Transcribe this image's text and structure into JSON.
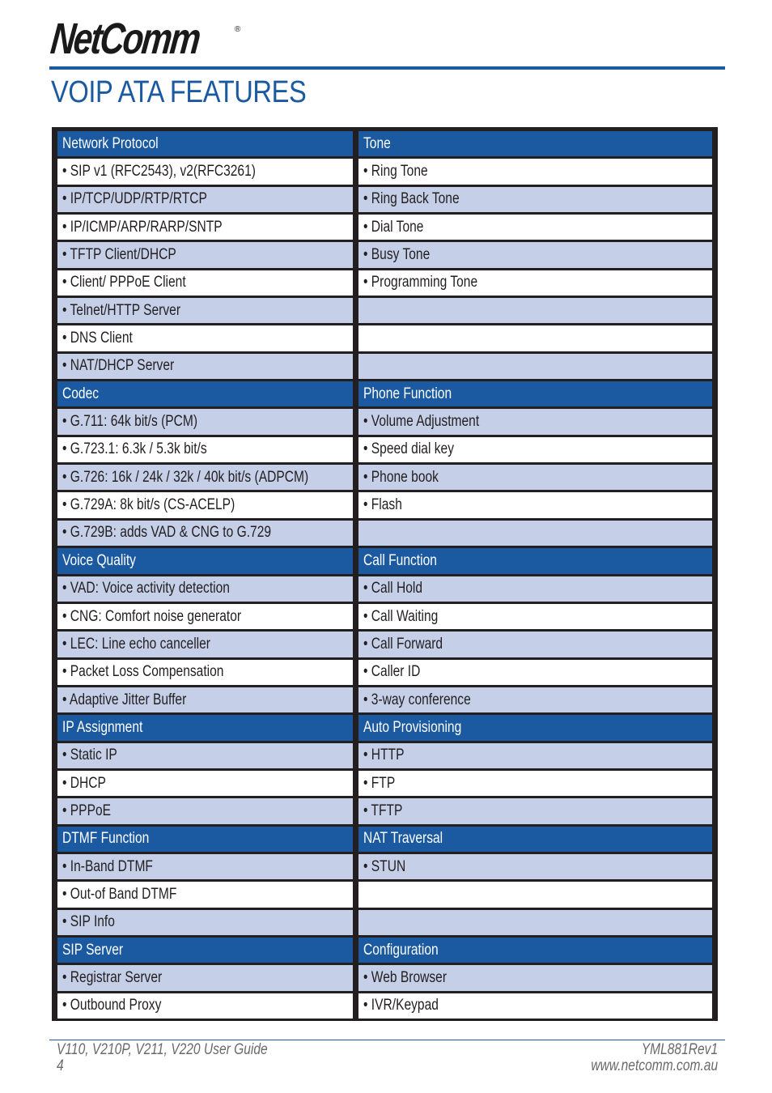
{
  "header": {
    "logo_text": "NetComm",
    "logo_mark": "®",
    "title": "VOIP ATA FEATURES"
  },
  "colors": {
    "brand_blue": "#1b5aa0",
    "row_shade": "#c5cfe8",
    "frame": "#231f20"
  },
  "table": {
    "rows": [
      {
        "type": "head",
        "left": "Network Protocol",
        "right": "Tone"
      },
      {
        "type": "plain",
        "left": "• SIP v1 (RFC2543), v2(RFC3261)",
        "right": "• Ring Tone"
      },
      {
        "type": "shade",
        "left": "• IP/TCP/UDP/RTP/RTCP",
        "right": "• Ring Back Tone"
      },
      {
        "type": "plain",
        "left": "• IP/ICMP/ARP/RARP/SNTP",
        "right": "• Dial Tone"
      },
      {
        "type": "shade",
        "left": "• TFTP Client/DHCP",
        "right": "• Busy Tone"
      },
      {
        "type": "plain",
        "left": "• Client/ PPPoE Client",
        "right": "• Programming Tone"
      },
      {
        "type": "shade",
        "left": "• Telnet/HTTP Server",
        "right": ""
      },
      {
        "type": "plain",
        "left": "• DNS Client",
        "right": ""
      },
      {
        "type": "shade",
        "left": "• NAT/DHCP Server",
        "right": ""
      },
      {
        "type": "head",
        "left": "Codec",
        "right": "Phone Function"
      },
      {
        "type": "shade",
        "left": "• G.711: 64k bit/s (PCM)",
        "right": "• Volume Adjustment"
      },
      {
        "type": "plain",
        "left": "• G.723.1: 6.3k / 5.3k bit/s",
        "right": "• Speed dial key"
      },
      {
        "type": "shade",
        "left": "• G.726: 16k / 24k / 32k / 40k bit/s (ADPCM)",
        "right": "• Phone book"
      },
      {
        "type": "plain",
        "left": "• G.729A: 8k bit/s (CS-ACELP)",
        "right": "• Flash"
      },
      {
        "type": "shade",
        "left": "• G.729B: adds VAD & CNG to G.729",
        "right": ""
      },
      {
        "type": "head",
        "left": "Voice Quality",
        "right": "Call Function"
      },
      {
        "type": "shade",
        "left": "• VAD: Voice activity detection",
        "right": "• Call Hold"
      },
      {
        "type": "plain",
        "left": "• CNG: Comfort noise generator",
        "right": "• Call Waiting"
      },
      {
        "type": "shade",
        "left": "• LEC: Line echo canceller",
        "right": "• Call Forward"
      },
      {
        "type": "plain",
        "left": "• Packet Loss Compensation",
        "right": "• Caller ID"
      },
      {
        "type": "shade",
        "left": "• Adaptive Jitter Buffer",
        "right": "• 3-way conference"
      },
      {
        "type": "head",
        "left": "IP Assignment",
        "right": "Auto Provisioning"
      },
      {
        "type": "shade",
        "left": "• Static IP",
        "right": "• HTTP"
      },
      {
        "type": "plain",
        "left": "• DHCP",
        "right": "• FTP"
      },
      {
        "type": "shade",
        "left": "• PPPoE",
        "right": "• TFTP"
      },
      {
        "type": "head",
        "left": "DTMF Function",
        "right": "NAT Traversal"
      },
      {
        "type": "shade",
        "left": "• In-Band DTMF",
        "right": "• STUN"
      },
      {
        "type": "plain",
        "left": "• Out-of Band DTMF",
        "right": ""
      },
      {
        "type": "shade",
        "left": "• SIP Info",
        "right": ""
      },
      {
        "type": "head",
        "left": "SIP Server",
        "right": "Configuration"
      },
      {
        "type": "shade",
        "left": "• Registrar Server",
        "right": "• Web Browser"
      },
      {
        "type": "plain",
        "left": "• Outbound Proxy",
        "right": "• IVR/Keypad"
      }
    ]
  },
  "footer": {
    "guide": "V110, V210P, V211, V220 User Guide",
    "page_number": "4",
    "doc_code": "YML881Rev1",
    "website": "www.netcomm.com.au"
  }
}
